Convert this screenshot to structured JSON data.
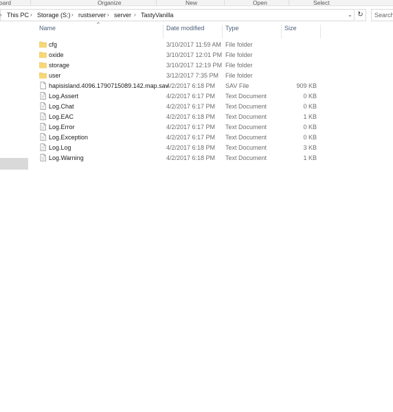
{
  "ribbon": {
    "groups": [
      "oard",
      "Organize",
      "New",
      "Open",
      "Select"
    ]
  },
  "address": {
    "crumbs": [
      "This PC",
      "Storage (S:)",
      "rustserver",
      "server",
      "TastyVanilla"
    ],
    "separator": "›",
    "leading_separator": "›",
    "dropdown_glyph": "⌄",
    "refresh_glyph": "↻",
    "search_placeholder": "Search"
  },
  "columns": {
    "name": "Name",
    "date": "Date modified",
    "type": "Type",
    "size": "Size",
    "sort_glyph": "^"
  },
  "files": [
    {
      "name": "cfg",
      "date": "3/10/2017 11:59 AM",
      "type": "File folder",
      "size": "",
      "icon": "folder-icon"
    },
    {
      "name": "oxide",
      "date": "3/10/2017 12:01 PM",
      "type": "File folder",
      "size": "",
      "icon": "folder-icon"
    },
    {
      "name": "storage",
      "date": "3/10/2017 12:19 PM",
      "type": "File folder",
      "size": "",
      "icon": "folder-icon"
    },
    {
      "name": "user",
      "date": "3/12/2017 7:35 PM",
      "type": "File folder",
      "size": "",
      "icon": "folder-icon"
    },
    {
      "name": "hapisisland.4096.1790715089.142.map.sav",
      "date": "4/2/2017 6:18 PM",
      "type": "SAV File",
      "size": "909 KB",
      "icon": "file-icon"
    },
    {
      "name": "Log.Assert",
      "date": "4/2/2017 6:17 PM",
      "type": "Text Document",
      "size": "0 KB",
      "icon": "text-file-icon"
    },
    {
      "name": "Log.Chat",
      "date": "4/2/2017 6:17 PM",
      "type": "Text Document",
      "size": "0 KB",
      "icon": "text-file-icon"
    },
    {
      "name": "Log.EAC",
      "date": "4/2/2017 6:18 PM",
      "type": "Text Document",
      "size": "1 KB",
      "icon": "text-file-icon"
    },
    {
      "name": "Log.Error",
      "date": "4/2/2017 6:17 PM",
      "type": "Text Document",
      "size": "0 KB",
      "icon": "text-file-icon"
    },
    {
      "name": "Log.Exception",
      "date": "4/2/2017 6:17 PM",
      "type": "Text Document",
      "size": "0 KB",
      "icon": "text-file-icon"
    },
    {
      "name": "Log.Log",
      "date": "4/2/2017 6:18 PM",
      "type": "Text Document",
      "size": "3 KB",
      "icon": "text-file-icon"
    },
    {
      "name": "Log.Warning",
      "date": "4/2/2017 6:18 PM",
      "type": "Text Document",
      "size": "1 KB",
      "icon": "text-file-icon"
    }
  ],
  "colors": {
    "folder": "#f8d775",
    "folder_dark": "#e0b84e",
    "header_text": "#4c607a",
    "nav_selected": "#d9d9d9"
  }
}
